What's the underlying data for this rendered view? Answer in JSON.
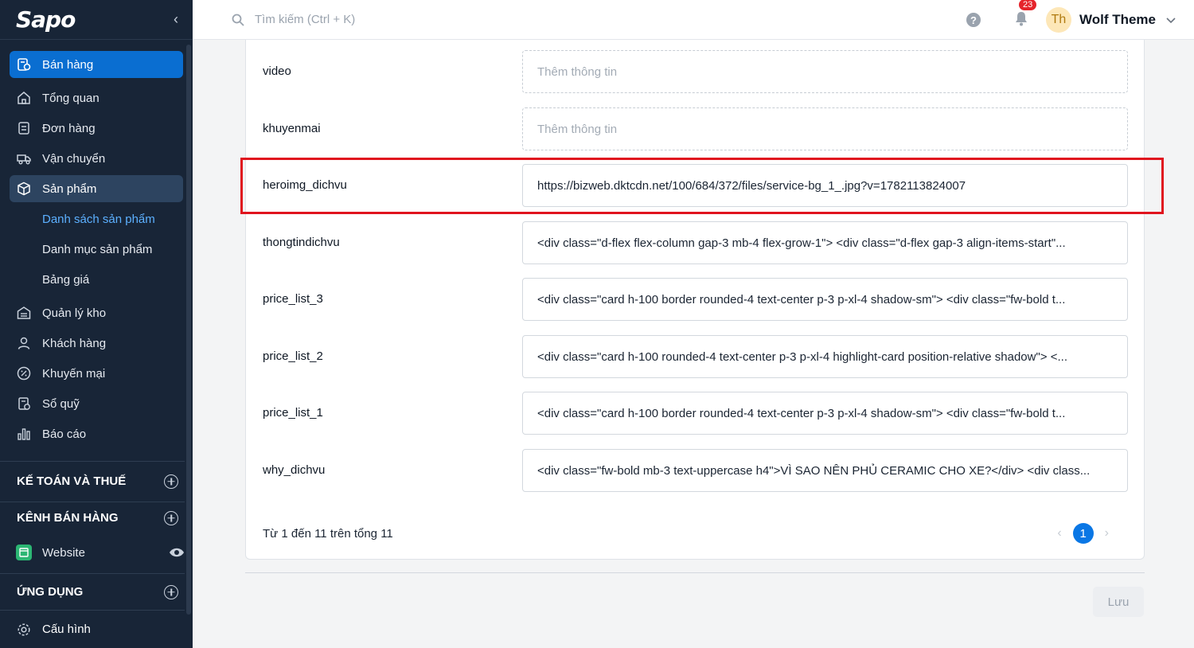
{
  "app": {
    "logo": "Sapo"
  },
  "search": {
    "placeholder": "Tìm kiếm (Ctrl + K)"
  },
  "header": {
    "notifications_count": "23",
    "user_initials": "Th",
    "user_name": "Wolf Theme"
  },
  "sidebar": {
    "items": [
      {
        "label": "Bán hàng"
      },
      {
        "label": "Tổng quan"
      },
      {
        "label": "Đơn hàng"
      },
      {
        "label": "Vận chuyển"
      },
      {
        "label": "Sản phẩm"
      }
    ],
    "sub_items": [
      {
        "label": "Danh sách sản phẩm"
      },
      {
        "label": "Danh mục sản phẩm"
      },
      {
        "label": "Bảng giá"
      }
    ],
    "items2": [
      {
        "label": "Quản lý kho"
      },
      {
        "label": "Khách hàng"
      },
      {
        "label": "Khuyến mại"
      },
      {
        "label": "Sổ quỹ"
      },
      {
        "label": "Báo cáo"
      }
    ],
    "sections": {
      "accounting": "KẾ TOÁN VÀ THUẾ",
      "channels": "KÊNH BÁN HÀNG",
      "website": "Website",
      "apps": "ỨNG DỤNG",
      "settings": "Cấu hình"
    }
  },
  "fields": [
    {
      "key": "video",
      "value": "Thêm thông tin"
    },
    {
      "key": "khuyenmai",
      "value": "Thêm thông tin"
    },
    {
      "key": "heroimg_dichvu",
      "value": "https://bizweb.dktcdn.net/100/684/372/files/service-bg_1_.jpg?v=1782113824007"
    },
    {
      "key": "thongtindichvu",
      "value": "<div class=\"d-flex flex-column gap-3 mb-4 flex-grow-1\"> <div class=\"d-flex gap-3 align-items-start\"..."
    },
    {
      "key": "price_list_3",
      "value": "<div class=\"card h-100 border rounded-4 text-center p-3 p-xl-4 shadow-sm\"> <div class=\"fw-bold t..."
    },
    {
      "key": "price_list_2",
      "value": "<div class=\"card h-100 rounded-4 text-center p-3 p-xl-4 highlight-card position-relative shadow\"> <..."
    },
    {
      "key": "price_list_1",
      "value": "<div class=\"card h-100 border rounded-4 text-center p-3 p-xl-4 shadow-sm\"> <div class=\"fw-bold t..."
    },
    {
      "key": "why_dichvu",
      "value": "<div class=\"fw-bold mb-3 text-uppercase h4\">VÌ SAO NÊN PHỦ CERAMIC CHO XE?</div> <div class..."
    }
  ],
  "pagination": {
    "summary": "Từ 1 đến 11 trên tổng 11",
    "current_page": "1",
    "prev": "‹",
    "next": "›"
  },
  "actions": {
    "save_label": "Lưu"
  },
  "icons": {
    "search": "search-icon",
    "help": "help-icon",
    "bell": "bell-icon",
    "chevron": "chevron-down-icon"
  }
}
